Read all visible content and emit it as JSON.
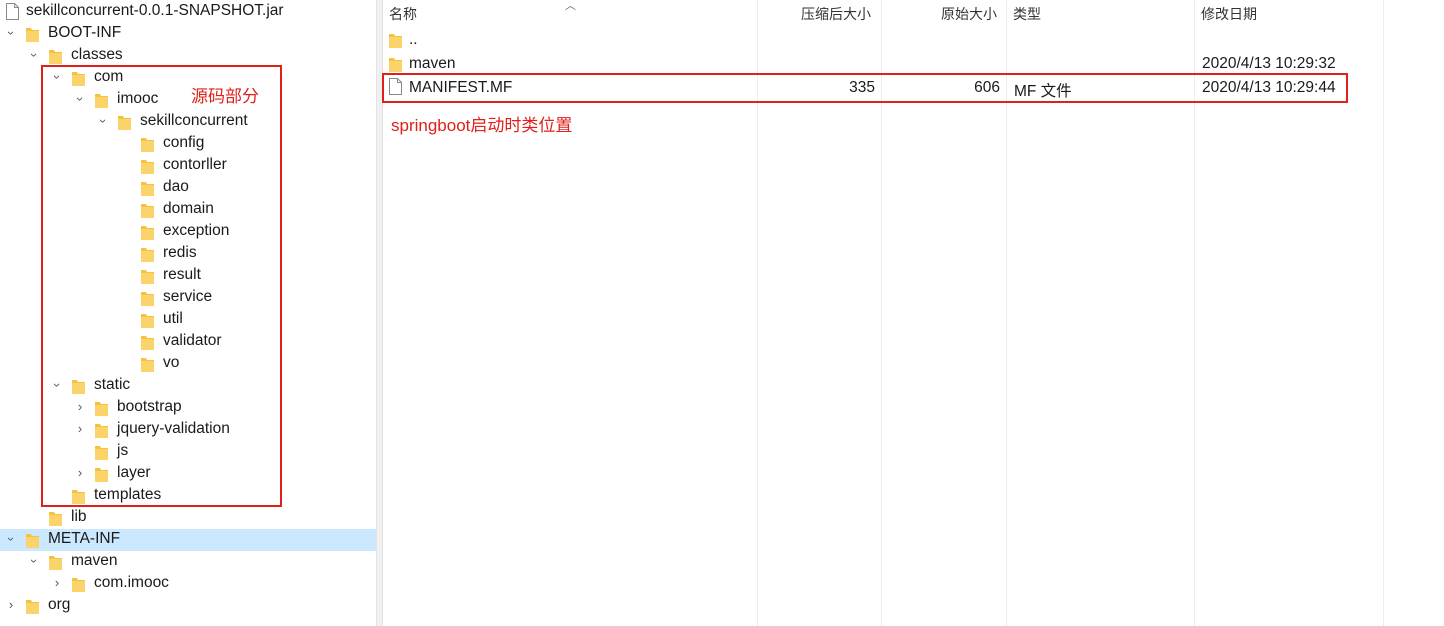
{
  "tree": {
    "nodes": [
      {
        "label": "sekillconcurrent-0.0.1-SNAPSHOT.jar",
        "icon": "file-icon",
        "depth": 0,
        "state": "none"
      },
      {
        "label": "BOOT-INF",
        "icon": "folder-icon",
        "depth": 0,
        "state": "open"
      },
      {
        "label": "classes",
        "icon": "folder-icon",
        "depth": 1,
        "state": "open"
      },
      {
        "label": "com",
        "icon": "folder-icon",
        "depth": 2,
        "state": "open"
      },
      {
        "label": "imooc",
        "icon": "folder-icon",
        "depth": 3,
        "state": "open"
      },
      {
        "label": "sekillconcurrent",
        "icon": "folder-icon",
        "depth": 4,
        "state": "open"
      },
      {
        "label": "config",
        "icon": "folder-icon",
        "depth": 5,
        "state": "none"
      },
      {
        "label": "contorller",
        "icon": "folder-icon",
        "depth": 5,
        "state": "none"
      },
      {
        "label": "dao",
        "icon": "folder-icon",
        "depth": 5,
        "state": "none"
      },
      {
        "label": "domain",
        "icon": "folder-icon",
        "depth": 5,
        "state": "none"
      },
      {
        "label": "exception",
        "icon": "folder-icon",
        "depth": 5,
        "state": "none"
      },
      {
        "label": "redis",
        "icon": "folder-icon",
        "depth": 5,
        "state": "none"
      },
      {
        "label": "result",
        "icon": "folder-icon",
        "depth": 5,
        "state": "none"
      },
      {
        "label": "service",
        "icon": "folder-icon",
        "depth": 5,
        "state": "none"
      },
      {
        "label": "util",
        "icon": "folder-icon",
        "depth": 5,
        "state": "none"
      },
      {
        "label": "validator",
        "icon": "folder-icon",
        "depth": 5,
        "state": "none"
      },
      {
        "label": "vo",
        "icon": "folder-icon",
        "depth": 5,
        "state": "none"
      },
      {
        "label": "static",
        "icon": "folder-icon",
        "depth": 2,
        "state": "open"
      },
      {
        "label": "bootstrap",
        "icon": "folder-icon",
        "depth": 3,
        "state": "closed"
      },
      {
        "label": "jquery-validation",
        "icon": "folder-icon",
        "depth": 3,
        "state": "closed"
      },
      {
        "label": "js",
        "icon": "folder-icon",
        "depth": 3,
        "state": "none"
      },
      {
        "label": "layer",
        "icon": "folder-icon",
        "depth": 3,
        "state": "closed"
      },
      {
        "label": "templates",
        "icon": "folder-icon",
        "depth": 2,
        "state": "none"
      },
      {
        "label": "lib",
        "icon": "folder-icon",
        "depth": 1,
        "state": "none"
      },
      {
        "label": "META-INF",
        "icon": "folder-icon",
        "depth": 0,
        "state": "open",
        "selected": true
      },
      {
        "label": "maven",
        "icon": "folder-icon",
        "depth": 1,
        "state": "open"
      },
      {
        "label": "com.imooc",
        "icon": "folder-icon",
        "depth": 2,
        "state": "closed"
      },
      {
        "label": "org",
        "icon": "folder-icon",
        "depth": 0,
        "state": "closed"
      }
    ]
  },
  "list": {
    "columns": {
      "name": "名称",
      "compressed": "压缩后大小",
      "original": "原始大小",
      "type": "类型",
      "modified": "修改日期"
    },
    "rows": [
      {
        "name": "..",
        "icon": "folder-icon",
        "compressed": "",
        "original": "",
        "type": "",
        "modified": ""
      },
      {
        "name": "maven",
        "icon": "folder-icon",
        "compressed": "",
        "original": "",
        "type": "",
        "modified": "2020/4/13 10:29:32"
      },
      {
        "name": "MANIFEST.MF",
        "icon": "file-icon",
        "compressed": "335",
        "original": "606",
        "type": "MF 文件",
        "modified": "2020/4/13 10:29:44"
      }
    ]
  },
  "annotations": {
    "source_label": "源码部分",
    "springboot_label": "springboot启动时类位置"
  },
  "colors": {
    "folder": "#f5c23e",
    "annotation": "#e0201a",
    "selected": "#cce8ff"
  }
}
